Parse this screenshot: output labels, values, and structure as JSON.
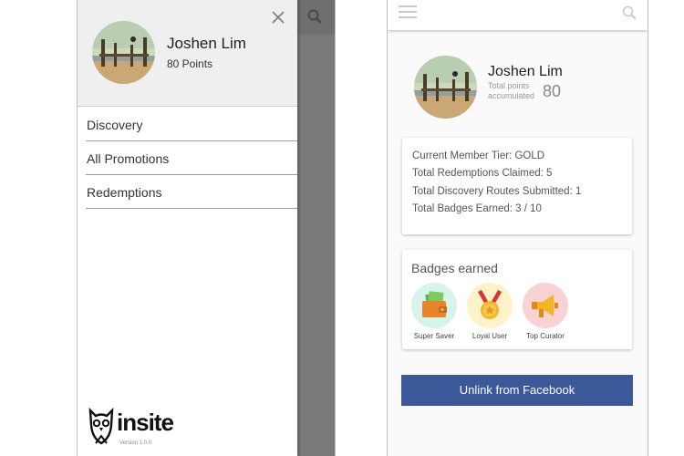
{
  "drawer": {
    "user_name": "Joshen Lim",
    "user_points": "80 Points",
    "menu": [
      {
        "label": "Discovery"
      },
      {
        "label": "All Promotions"
      },
      {
        "label": "Redemptions"
      }
    ],
    "brand_name": "insite",
    "version": "Version 1.0.0"
  },
  "profile": {
    "name": "Joshen Lim",
    "points_label": "Total points accumulated",
    "points_value": "80",
    "stats": [
      {
        "text": "Current Member Tier: GOLD"
      },
      {
        "text": "Total Redemptions Claimed: 5"
      },
      {
        "text": "Total Discovery Routes Submitted: 1"
      },
      {
        "text": "Total Badges Earned: 3 / 10"
      }
    ],
    "badges_title": "Badges earned",
    "badges": [
      {
        "label": "Super Saver",
        "icon": "wallet-icon",
        "color": "#d6f3ec"
      },
      {
        "label": "Loyal User",
        "icon": "medal-icon",
        "color": "#fdf2c8"
      },
      {
        "label": "Top Curator",
        "icon": "megaphone-icon",
        "color": "#f9d3d3"
      }
    ],
    "unlink_label": "Unlink from Facebook"
  },
  "colors": {
    "facebook_blue": "#3b5998",
    "overlay_gray": "#7a7a7a",
    "drawer_header": "#efefef"
  }
}
